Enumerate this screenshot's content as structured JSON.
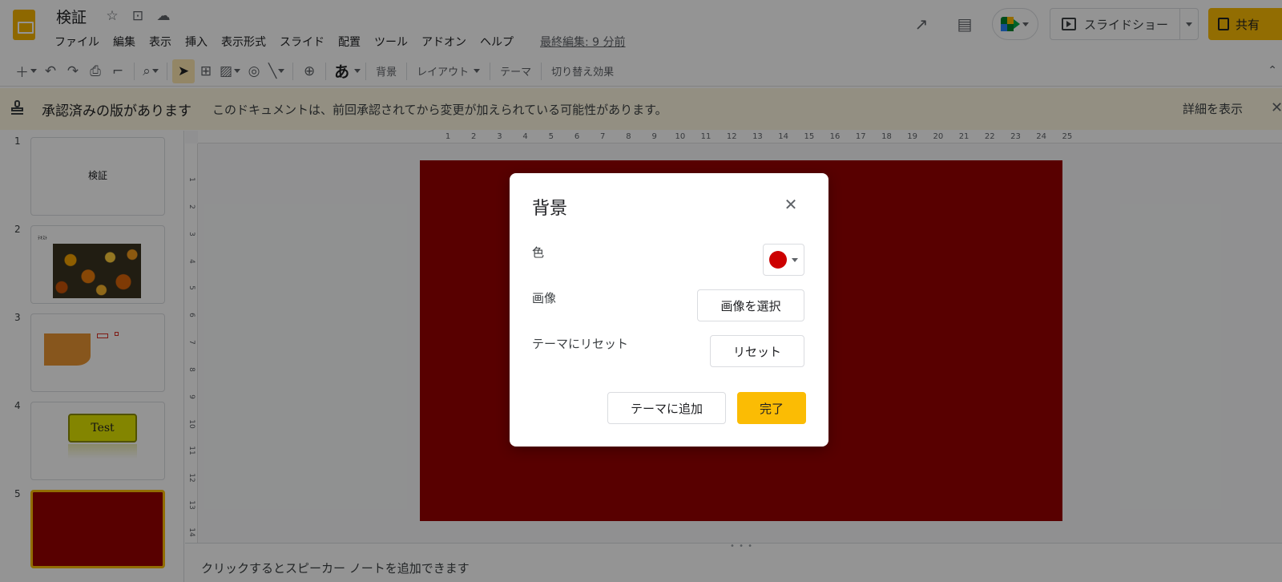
{
  "app": {
    "title": "検証",
    "last_edit": "最終編集: 9 分前"
  },
  "menu": [
    "ファイル",
    "編集",
    "表示",
    "挿入",
    "表示形式",
    "スライド",
    "配置",
    "ツール",
    "アドオン",
    "ヘルプ"
  ],
  "header": {
    "slideshow_label": "スライドショー",
    "share_label": "共有"
  },
  "toolbar": {
    "font_glyph": "あ",
    "background": "背景",
    "layout": "レイアウト",
    "theme": "テーマ",
    "transition": "切り替え効果"
  },
  "banner": {
    "title": "承認済みの版があります",
    "message": "このドキュメントは、前回承認されてから変更が加えられている可能性があります。",
    "details_link": "詳細を表示"
  },
  "slides": [
    {
      "number": "1",
      "text": "検証"
    },
    {
      "number": "2",
      "label": "ﾃｷｽﾄ"
    },
    {
      "number": "3"
    },
    {
      "number": "4",
      "text": "Test"
    },
    {
      "number": "5"
    }
  ],
  "ruler": {
    "horizontal": [
      "1",
      "2",
      "3",
      "4",
      "5",
      "6",
      "7",
      "8",
      "9",
      "10",
      "11",
      "12",
      "13",
      "14",
      "15",
      "16",
      "17",
      "18",
      "19",
      "20",
      "21",
      "22",
      "23",
      "24",
      "25"
    ],
    "vertical": [
      "1",
      "2",
      "3",
      "4",
      "5",
      "6",
      "7",
      "8",
      "9",
      "10",
      "11",
      "12",
      "13",
      "14"
    ]
  },
  "notes_placeholder": "クリックするとスピーカー ノートを追加できます",
  "dialog": {
    "title": "背景",
    "color_label": "色",
    "color_value": "#cc0000",
    "image_label": "画像",
    "choose_image_button": "画像を選択",
    "reset_label": "テーマにリセット",
    "reset_button": "リセット",
    "add_to_theme_button": "テーマに追加",
    "done_button": "完了"
  },
  "colors": {
    "slide_background": "#980000",
    "accent": "#fbbc04"
  }
}
